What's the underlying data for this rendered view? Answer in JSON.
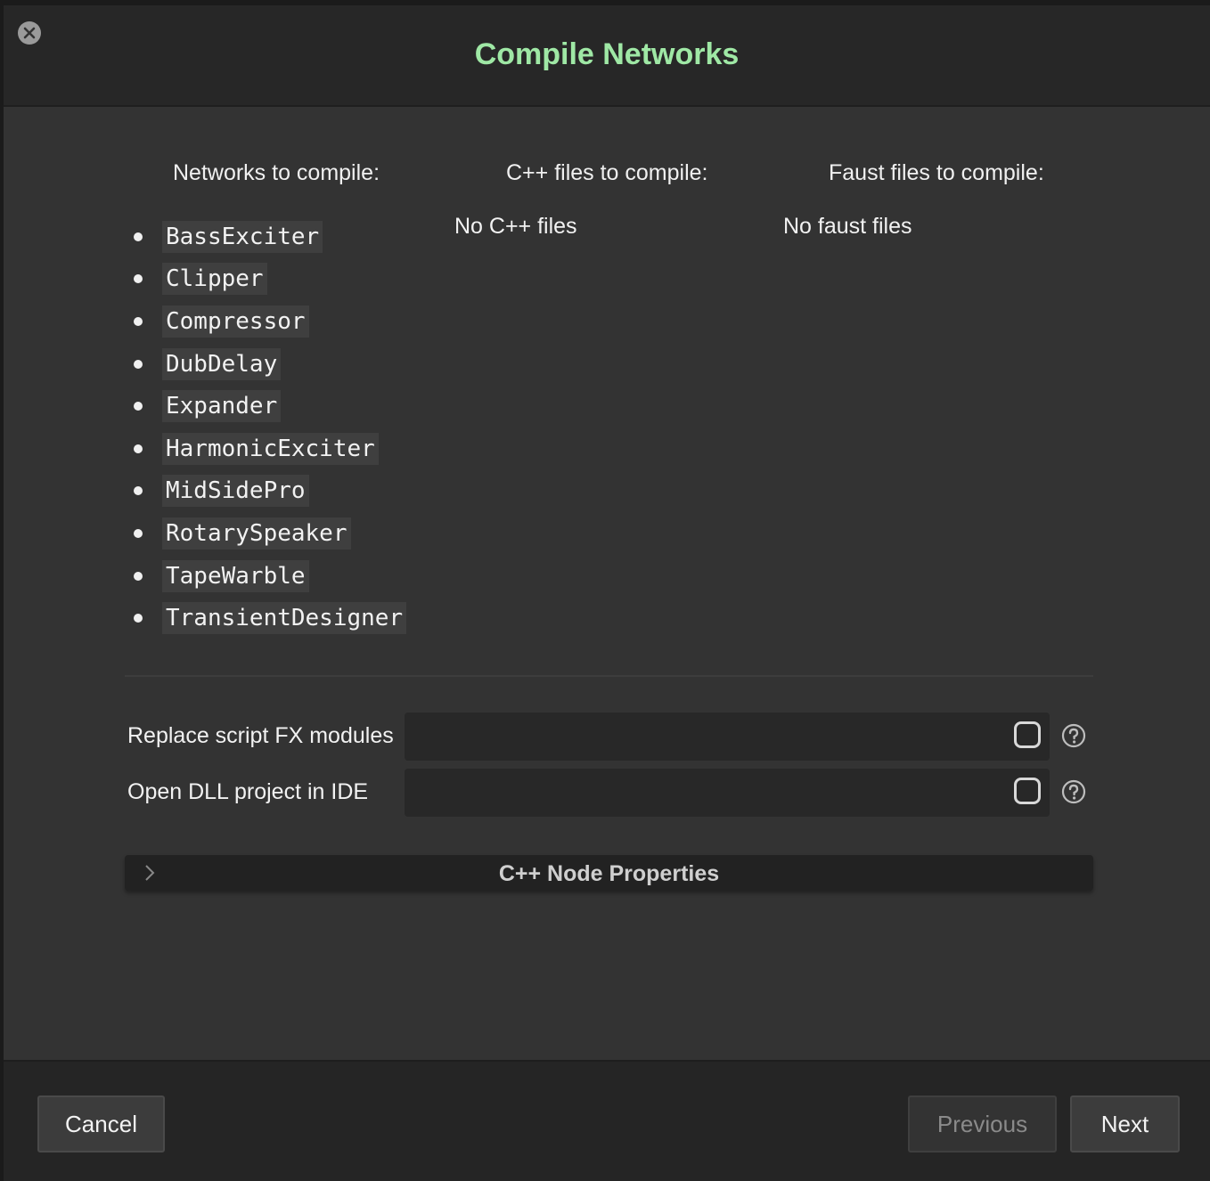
{
  "dialog": {
    "title": "Compile Networks",
    "close_icon": "close-icon"
  },
  "columns": {
    "networks_header": "Networks to compile:",
    "cpp_header": "C++ files to compile:",
    "faust_header": "Faust files to compile:",
    "cpp_empty": "No C++ files",
    "faust_empty": "No faust files"
  },
  "networks": [
    "BassExciter",
    "Clipper",
    "Compressor",
    "DubDelay",
    "Expander",
    "HarmonicExciter",
    "MidSidePro",
    "RotarySpeaker",
    "TapeWarble",
    "TransientDesigner"
  ],
  "properties": {
    "replace_label": "Replace script FX modules",
    "replace_checked": false,
    "open_dll_label": "Open DLL project in IDE",
    "open_dll_checked": false
  },
  "node_properties": {
    "label": "C++ Node Properties",
    "expanded": false
  },
  "footer": {
    "cancel_label": "Cancel",
    "previous_label": "Previous",
    "next_label": "Next"
  },
  "colors": {
    "title": "#9fe8a5",
    "background": "#333333",
    "header": "#272727"
  }
}
